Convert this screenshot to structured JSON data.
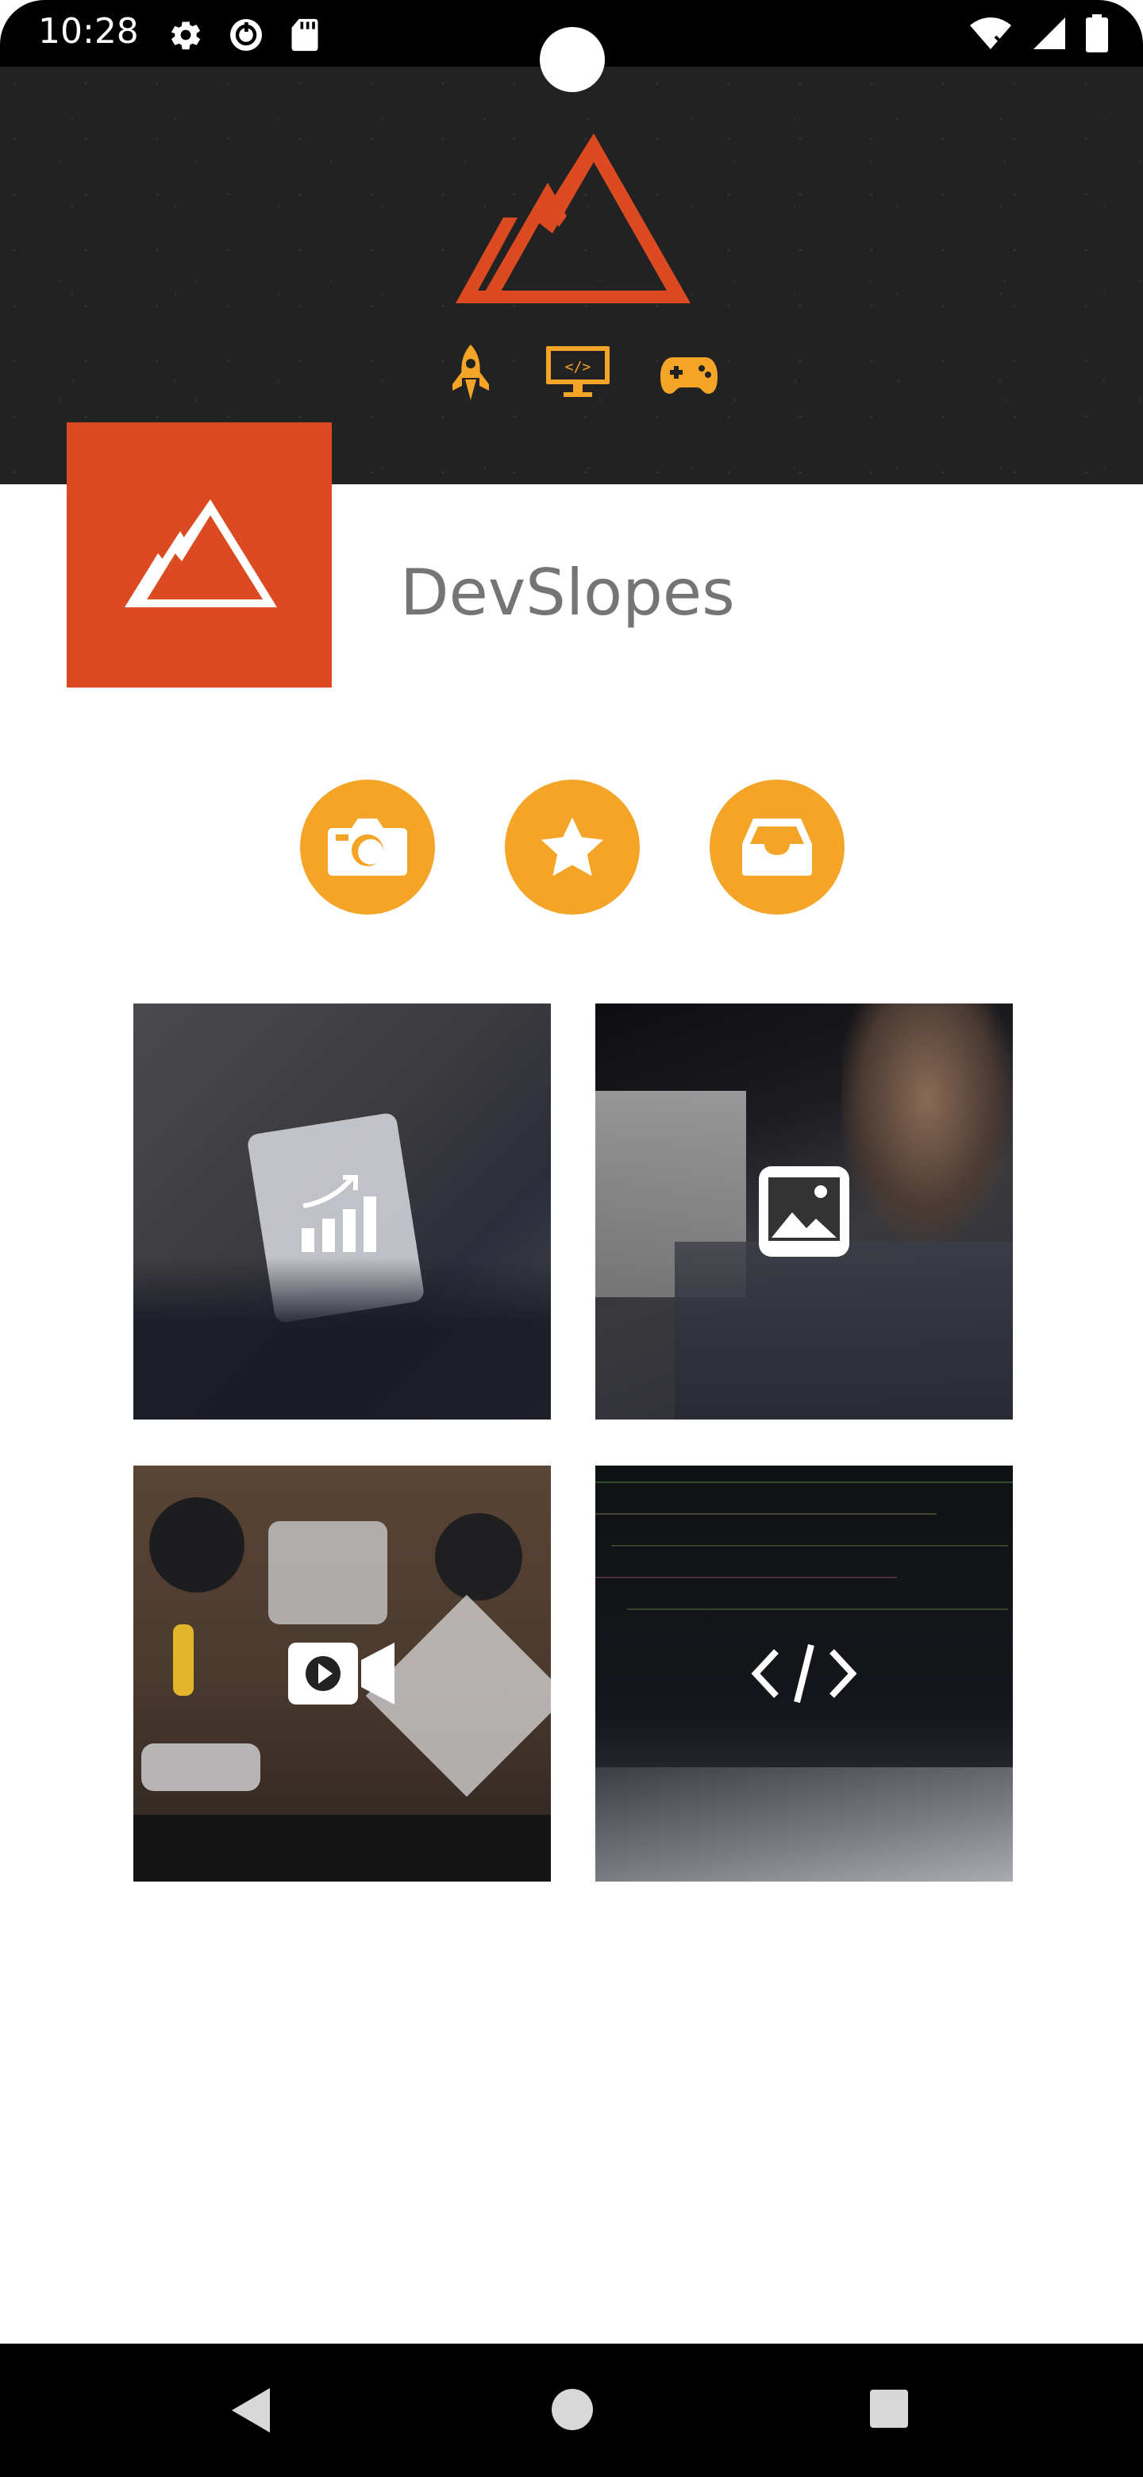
{
  "status_bar": {
    "time": "10:28",
    "left_icons": [
      "gear-icon",
      "sync-icon",
      "sd-card-icon"
    ],
    "right_icons": [
      "wifi-icon",
      "signal-icon",
      "battery-icon"
    ]
  },
  "header": {
    "logo": "mountain-logo",
    "category_icons": [
      "rocket-icon",
      "code-monitor-icon",
      "gamepad-icon"
    ]
  },
  "profile": {
    "name": "DevSlopes",
    "avatar": "mountain-logo"
  },
  "actions": [
    {
      "icon": "camera-icon"
    },
    {
      "icon": "star-icon"
    },
    {
      "icon": "inbox-icon"
    }
  ],
  "tiles": [
    {
      "icon": "analytics-icon",
      "photo": "tablet-chart-photo"
    },
    {
      "icon": "image-icon",
      "photo": "man-portrait-photo"
    },
    {
      "icon": "video-camera-icon",
      "photo": "camera-gear-photo"
    },
    {
      "icon": "code-icon",
      "photo": "laptop-code-photo"
    }
  ],
  "nav": [
    "back-icon",
    "home-icon",
    "recents-icon"
  ],
  "colors": {
    "brand_orange": "#db4a20",
    "accent_yellow": "#f4a426",
    "header_dark": "#222222",
    "name_gray": "#757575"
  }
}
